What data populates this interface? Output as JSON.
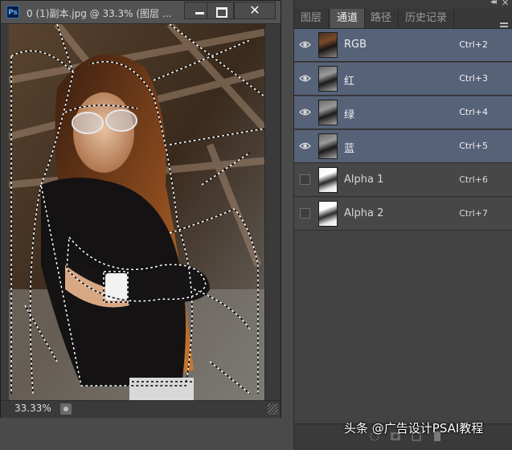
{
  "document": {
    "title": "0 (1)副本.jpg @ 33.3% (图层 ...",
    "app_badge": "Ps",
    "zoom": "33.33%"
  },
  "panel": {
    "tabs": [
      {
        "label": "图层",
        "active": false
      },
      {
        "label": "通道",
        "active": true
      },
      {
        "label": "路径",
        "active": false
      },
      {
        "label": "历史记录",
        "active": false
      }
    ],
    "channels": [
      {
        "name": "RGB",
        "shortcut": "Ctrl+2",
        "visible": true,
        "selected": true,
        "thumb": "color"
      },
      {
        "name": "红",
        "shortcut": "Ctrl+3",
        "visible": true,
        "selected": true,
        "thumb": "gray"
      },
      {
        "name": "绿",
        "shortcut": "Ctrl+4",
        "visible": true,
        "selected": true,
        "thumb": "gray"
      },
      {
        "name": "蓝",
        "shortcut": "Ctrl+5",
        "visible": true,
        "selected": true,
        "thumb": "gray"
      },
      {
        "name": "Alpha 1",
        "shortcut": "Ctrl+6",
        "visible": false,
        "selected": false,
        "thumb": "mask"
      },
      {
        "name": "Alpha 2",
        "shortcut": "Ctrl+7",
        "visible": false,
        "selected": false,
        "thumb": "mask"
      }
    ]
  },
  "watermark": "头条 @广告设计PSAI教程",
  "colors": {
    "selected_row": "#566278",
    "panel_bg": "#434343",
    "chrome": "#535353"
  }
}
